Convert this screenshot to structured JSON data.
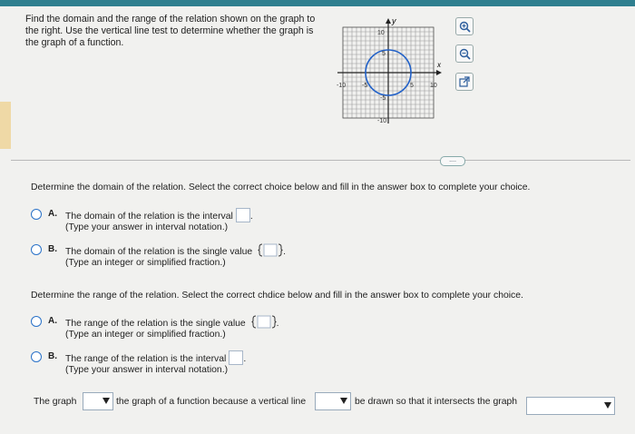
{
  "question": {
    "prompt": "Find the domain and the range of the relation shown on the graph to the right. Use the vertical line test to determine whether the graph is the graph of a function."
  },
  "graph": {
    "y_label": "y",
    "x_label": "x",
    "ticks": {
      "top": "10",
      "y5": "5",
      "left": "-10",
      "xm5": "-5",
      "ym5": "-5",
      "x5": "5",
      "right": "10",
      "bottom": "-10"
    },
    "circle": {
      "center": [
        0,
        0
      ],
      "radius": 5
    }
  },
  "tools": {
    "zoom_in": "zoom-in",
    "zoom_out": "zoom-out",
    "popout": "popout"
  },
  "more_label": "....",
  "domain": {
    "question": "Determine the domain of the relation. Select the correct choice below and fill in the answer box to complete your choice.",
    "a_letter": "A.",
    "a_text": "The domain of the relation is the interval",
    "a_hint": "(Type your answer in interval notation.)",
    "b_letter": "B.",
    "b_text": "The domain of the relation is the single value",
    "b_hint": "(Type an integer or simplified fraction.)"
  },
  "range": {
    "question": "Determine the range of the relation. Select the correct chdice below and fill in the answer box to complete your choice.",
    "a_letter": "A.",
    "a_text": "The range of the relation is the single value",
    "a_hint": "(Type an integer or simplified fraction.)",
    "b_letter": "B.",
    "b_text": "The range of the relation is the interval",
    "b_hint": "(Type your answer in interval notation.)"
  },
  "final": {
    "part1": "The graph",
    "part2": "the graph of a function because a vertical line",
    "part3": "be drawn so that it intersects the graph"
  }
}
